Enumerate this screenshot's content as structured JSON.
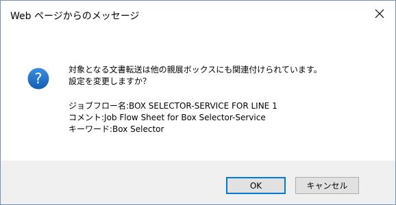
{
  "window": {
    "title": "Web ページからのメッセージ",
    "close_icon": "close-icon"
  },
  "message": {
    "icon": "question-icon",
    "icon_color": "#1e72c8",
    "line1": "対象となる文書転送は他の親展ボックスにも関連付けられています。",
    "line2": "設定を変更しますか？",
    "detail1": "ジョブフロー名:BOX SELECTOR-SERVICE FOR LINE 1",
    "detail2": "コメント:Job Flow Sheet for Box Selector-Service",
    "detail3": "キーワード:Box Selector"
  },
  "buttons": {
    "ok_label": "OK",
    "cancel_label": "キャンセル"
  },
  "colors": {
    "footer_bg": "#f0f0f0",
    "button_bg": "#e1e1e1",
    "focus_border": "#0078d7"
  }
}
